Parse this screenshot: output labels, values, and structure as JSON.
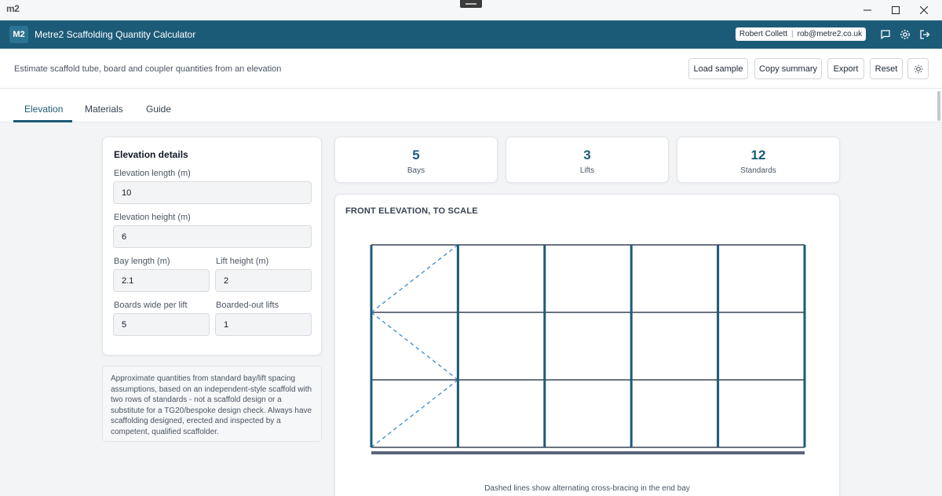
{
  "os": {
    "logo": "m2"
  },
  "app": {
    "logo": "M2",
    "title": "Metre2 Scaffolding Quantity Calculator",
    "user_name": "Robert Collett",
    "user_email": "rob@metre2.co.uk"
  },
  "toolbar": {
    "tagline": "Estimate scaffold tube, board and coupler quantities from an elevation",
    "load_sample": "Load sample",
    "copy_summary": "Copy summary",
    "export": "Export",
    "reset": "Reset"
  },
  "tabs": [
    {
      "label": "Elevation",
      "active": true
    },
    {
      "label": "Materials",
      "active": false
    },
    {
      "label": "Guide",
      "active": false
    }
  ],
  "details": {
    "title": "Elevation details",
    "length_label": "Elevation length (m)",
    "length_value": "10",
    "height_label": "Elevation height (m)",
    "height_value": "6",
    "bay_label": "Bay length (m)",
    "bay_value": "2.1",
    "lift_label": "Lift height (m)",
    "lift_value": "2",
    "boards_label": "Boards wide per lift",
    "boards_value": "5",
    "boarded_label": "Boarded-out lifts",
    "boarded_value": "1"
  },
  "note": "Approximate quantities from standard bay/lift spacing assumptions, based on an independent-style scaffold with two rows of standards - not a scaffold design or a substitute for a TG20/bespoke design check. Always have scaffolding designed, erected and inspected by a competent, qualified scaffolder.",
  "stats": [
    {
      "value": "5",
      "label": "Bays"
    },
    {
      "value": "3",
      "label": "Lifts"
    },
    {
      "value": "12",
      "label": "Standards"
    }
  ],
  "elevation": {
    "title": "FRONT ELEVATION, TO SCALE",
    "caption": "Dashed lines show alternating cross-bracing in the end bay",
    "bays": 5,
    "lifts": 3,
    "colors": {
      "standard": "#1c5b78",
      "ledger": "#6b7280",
      "brace": "#4a90c9",
      "base": "#5b6478"
    }
  }
}
